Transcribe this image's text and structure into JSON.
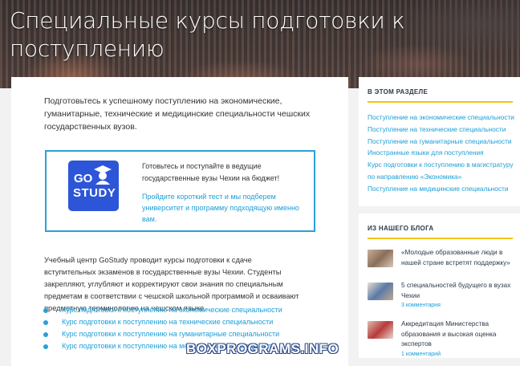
{
  "hero": {
    "title": "Специальные курсы подготовки к поступлению"
  },
  "main": {
    "intro": "Подготовьтесь к успешному поступлению на экономические, гуманитарные, технические и медицинские специальности чешских государственных вузов.",
    "promo": {
      "logo_top": "GO",
      "logo_bottom": "STUDY",
      "logo_color": "#2c55d8",
      "title": "Готовьтесь и поступайте в ведущие государственные вузы Чехии на бюджет!",
      "text": "Пройдите короткий тест и мы подберем университет и программу подходящую именно вам."
    },
    "body": "Учебный центр GoStudy проводит курсы подготовки к сдаче вступительных экзаменов в государственные вузы Чехии. Студенты закрепляют, углубляют и корректируют свои знания по специальным предметам в соответствии с чешской школьной программой и осваивают предметную терминологию на чешском языке.",
    "courses": [
      "Курс подготовки к поступлению на экономические специальности",
      "Курс подготовки к поступлению на технические специальности",
      "Курс подготовки к поступлению на гуманитарные специальности",
      "Курс подготовки к поступлению на медицинские специальности"
    ]
  },
  "sidebar": {
    "section": {
      "heading": "В ЭТОМ РАЗДЕЛЕ",
      "links": [
        "Поступление на экономические специальности",
        "Поступление на технические специальности",
        "Поступление на гуманитарные специальности",
        "Иностранные языки для поступления",
        "Курс подготовки к поступлению в магистратуру",
        "по направлению «Экономика»",
        "Поступление на медицинские специальности"
      ]
    },
    "blog": {
      "heading": "ИЗ НАШЕГО БЛОГА",
      "posts": [
        {
          "title": "«Молодые образованные люди в нашей стране встретят поддержку»",
          "meta": ""
        },
        {
          "title": "5 специальностей будущего в вузах Чехии",
          "meta": "3 комментария"
        },
        {
          "title": "Аккредитация Министерства образования и высокая оценка экспертов",
          "meta": "1 комментарий"
        }
      ]
    }
  },
  "watermark": "BOXPROGRAMS.INFO",
  "colors": {
    "accent": "#1a9ed8",
    "border": "#2aa0d8",
    "divider": "#f0c419"
  }
}
